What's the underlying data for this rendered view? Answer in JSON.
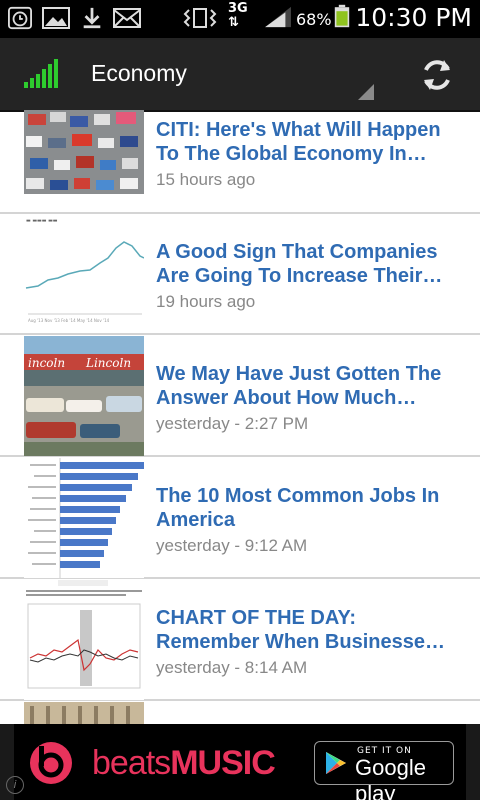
{
  "status_bar": {
    "time": "10:30 PM",
    "battery_percent": "68%",
    "network": "3G",
    "icons": [
      "alarm-icon",
      "gallery-icon",
      "download-icon",
      "mail-icon",
      "vibrate-icon",
      "network-3g-icon",
      "signal-icon",
      "battery-icon"
    ]
  },
  "action_bar": {
    "title": "Economy",
    "logo_icon": "signal-bars-logo-icon",
    "refresh_icon": "refresh-icon"
  },
  "articles": [
    {
      "headline": "CITI: Here's What Will Happen To The Global Economy In Th…",
      "time": "15 hours ago",
      "thumb": "cars-from-above"
    },
    {
      "headline": "A Good Sign That Companies Are Going To Increase Their…",
      "time": "19 hours ago",
      "thumb": "line-chart"
    },
    {
      "headline": "We May Have Just Gotten The Answer About How Much…",
      "time": "yesterday - 2:27 PM",
      "thumb": "lincoln-dealership"
    },
    {
      "headline": "The 10 Most Common Jobs In America",
      "time": "yesterday - 9:12 AM",
      "thumb": "bar-chart"
    },
    {
      "headline": "CHART OF THE DAY: Remember When Businesses Were…",
      "time": "yesterday - 8:14 AM",
      "thumb": "chart-of-day"
    }
  ],
  "ad": {
    "brand_light": "beats",
    "brand_bold": "MUSIC",
    "store_small": "GET IT ON",
    "store_big": "Google play",
    "info": "i"
  }
}
